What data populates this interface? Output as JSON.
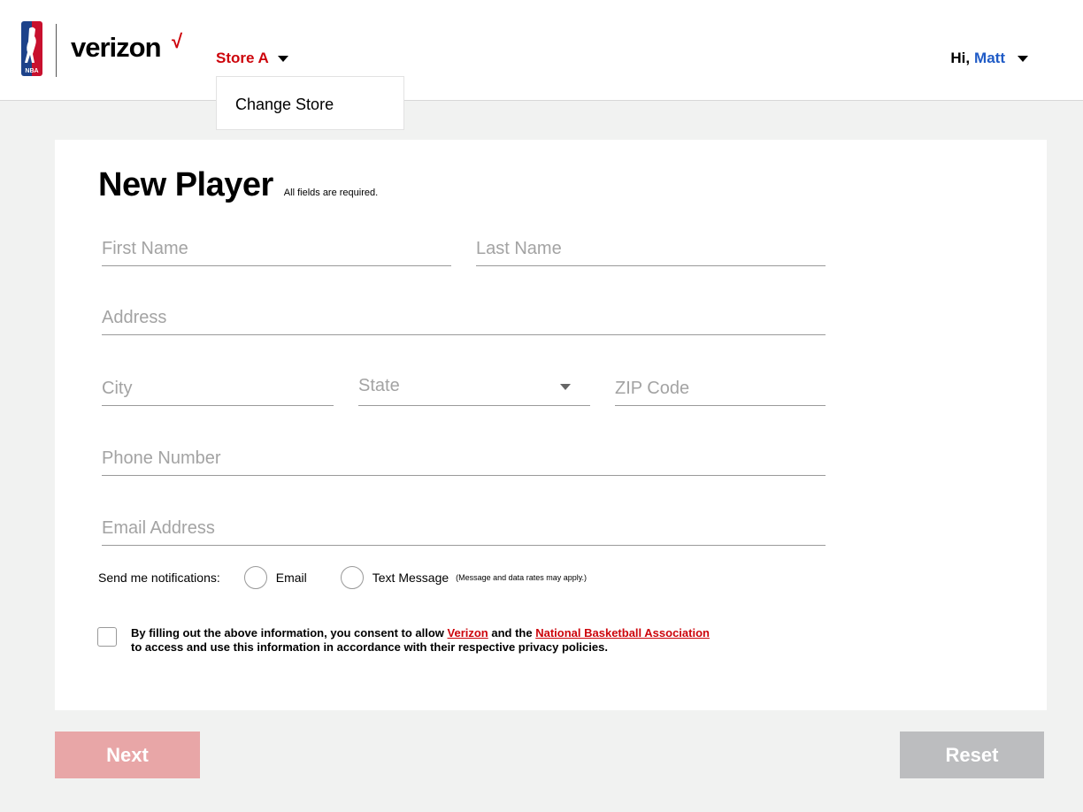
{
  "header": {
    "brand": "verizon",
    "brand_check": "√",
    "nba_logo_text": "NBA",
    "store": "Store A",
    "store_menu": [
      "Change Store"
    ],
    "greeting_prefix": "Hi,",
    "user_name": "Matt"
  },
  "form": {
    "title": "New Player",
    "required_note": "All fields are required.",
    "fields": {
      "first_name": {
        "placeholder": "First Name",
        "value": ""
      },
      "last_name": {
        "placeholder": "Last Name",
        "value": ""
      },
      "address": {
        "placeholder": "Address",
        "value": ""
      },
      "city": {
        "placeholder": "City",
        "value": ""
      },
      "state": {
        "placeholder": "State",
        "value": ""
      },
      "zip": {
        "placeholder": "ZIP Code",
        "value": ""
      },
      "phone": {
        "placeholder": "Phone Number",
        "value": ""
      },
      "email": {
        "placeholder": "Email Address",
        "value": ""
      }
    },
    "notifications": {
      "label": "Send me notifications:",
      "options": [
        "Email",
        "Text Message"
      ],
      "fine_print": "(Message and data rates may apply.)"
    },
    "consent": {
      "text_1": "By filling out the above information, you consent to allow ",
      "link_1": "Verizon",
      "text_2": " and the ",
      "link_2": "National Basketball Association",
      "text_3": "to access and use this information in accordance with their respective privacy policies."
    }
  },
  "buttons": {
    "next": "Next",
    "reset": "Reset"
  },
  "colors": {
    "brand_red": "#cd040b",
    "user_blue": "#1f5bc6",
    "next_disabled": "#e8a6a7",
    "reset_disabled": "#bcbdbf",
    "page_bg": "#f1f2f1"
  }
}
